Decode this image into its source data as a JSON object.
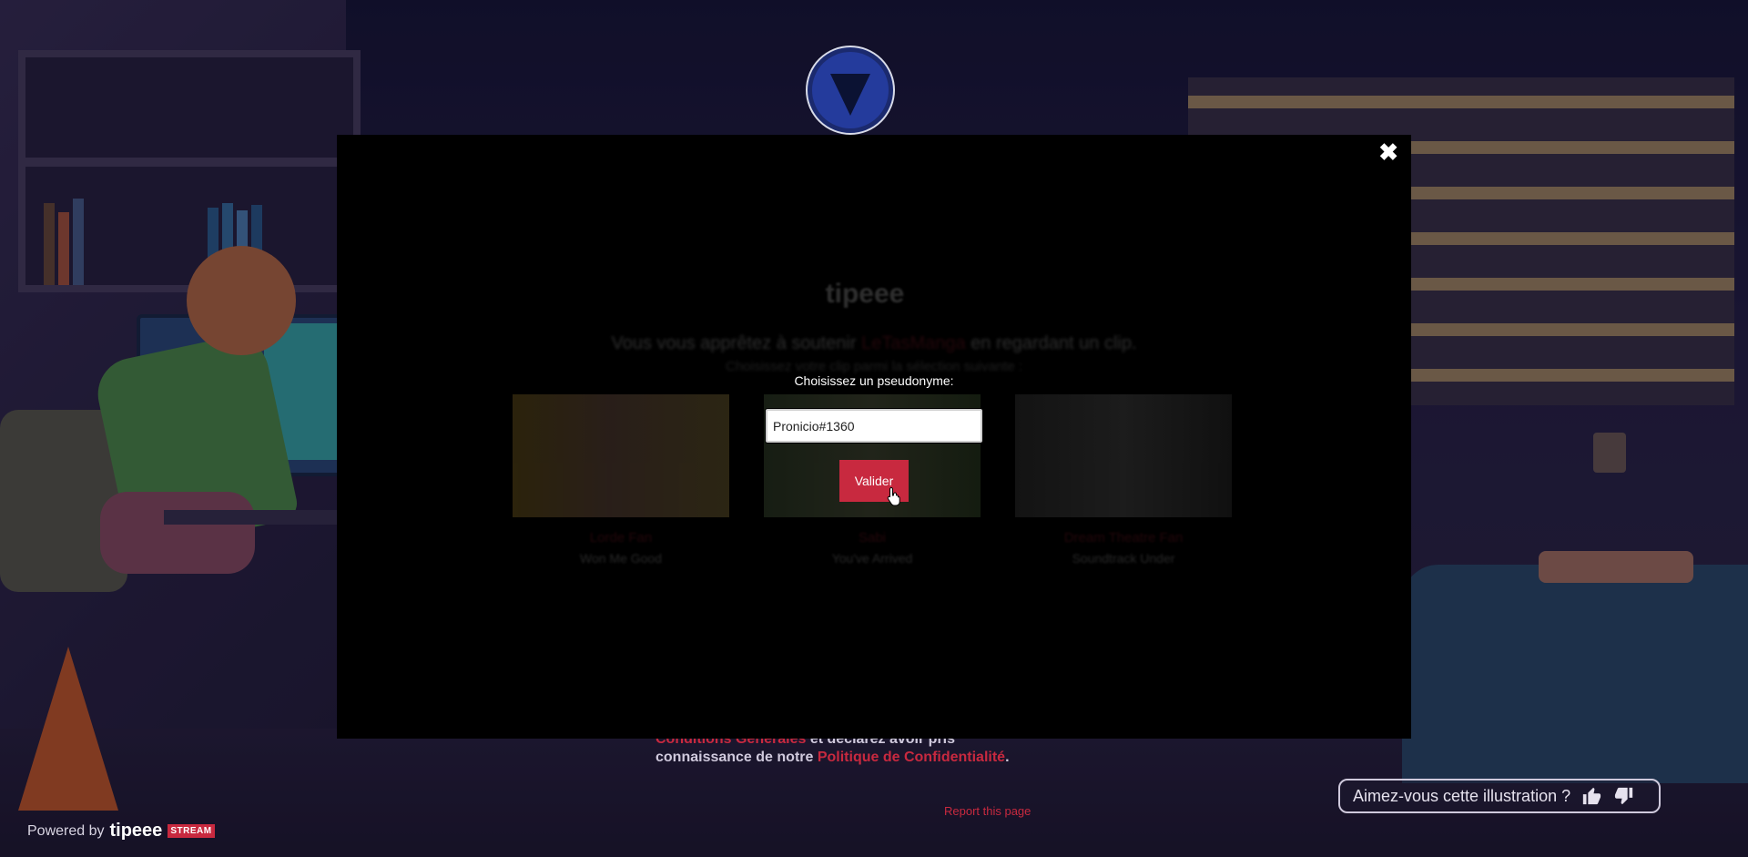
{
  "modal": {
    "close_symbol": "✖",
    "faded_logo": "tipeee",
    "faded_headline_prefix": "Vous vous apprêtez à soutenir",
    "faded_headline_accent": "LeTasManga",
    "faded_headline_suffix": "en regardant un clip.",
    "faded_subline": "Choisissez votre clip parmi la sélection suivante :",
    "cards": [
      {
        "title": "Lorde Fan",
        "subtitle": "Won Me Good"
      },
      {
        "title": "Sabi",
        "subtitle": "You've Arrived"
      },
      {
        "title": "Dream Theatre Fan",
        "subtitle": "Soundtrack Under"
      }
    ],
    "pseudo_label": "Choisissez un pseudonyme:",
    "pseudo_value": "Pronicio#1360",
    "submit_label": "Valider"
  },
  "footer": {
    "legal_part1": "Conditions Générales",
    "legal_part2": " et déclarez avoir pris",
    "legal_part3": "connaissance de notre ",
    "legal_link": "Politique de Confidentialité",
    "legal_end": ".",
    "report_link": "Report this page",
    "powered_by": "Powered by",
    "brand": "tipeee",
    "brand_tag": "STREAM"
  },
  "illustration_feedback": {
    "question": "Aimez-vous cette illustration ?"
  },
  "colors": {
    "accent": "#c8293f",
    "modal_bg": "#000000"
  },
  "icons": {
    "like": "thumbs-up-icon",
    "dislike": "thumbs-down-icon",
    "close": "close-icon"
  }
}
